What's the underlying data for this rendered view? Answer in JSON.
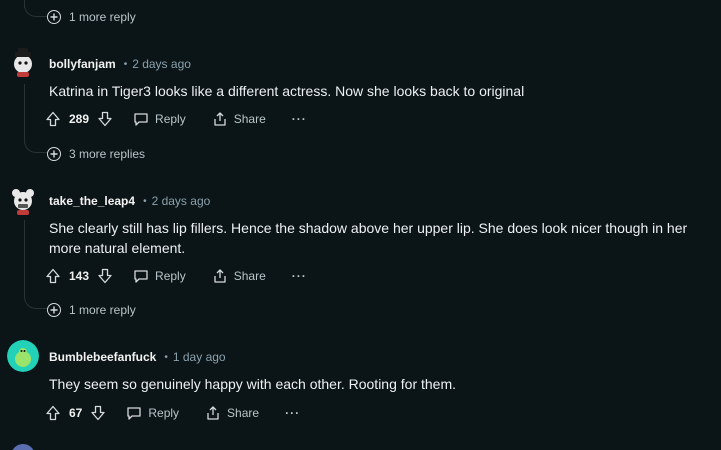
{
  "top_more_replies": {
    "label": "1 more reply"
  },
  "comments": [
    {
      "username": "bollyfanjam",
      "time": "2 days ago",
      "text": "Katrina in Tiger3 looks like a different actress. Now she looks back to original",
      "votes": "289",
      "reply_label": "Reply",
      "share_label": "Share",
      "more_label": "···",
      "more_replies": "3 more replies"
    },
    {
      "username": "take_the_leap4",
      "time": "2 days ago",
      "text": "She clearly still has lip fillers. Hence the shadow above her upper lip. She does look nicer though in her more natural element.",
      "votes": "143",
      "reply_label": "Reply",
      "share_label": "Share",
      "more_label": "···",
      "more_replies": "1 more reply"
    },
    {
      "username": "Bumblebeefanfuck",
      "time": "1 day ago",
      "text": "They seem so genuinely happy with each other. Rooting for them.",
      "votes": "67",
      "reply_label": "Reply",
      "share_label": "Share",
      "more_label": "···"
    }
  ],
  "colors": {
    "background": "#0b1416",
    "thread_line": "#2a3236",
    "meta_text": "#8ba2ad",
    "avatar_teal": "#22d1b7"
  }
}
